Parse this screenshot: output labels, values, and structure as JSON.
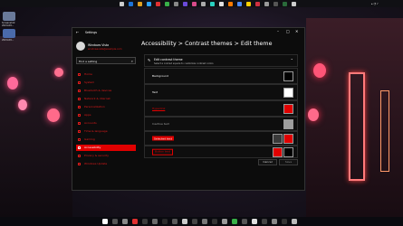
{
  "window": {
    "title": "Settings"
  },
  "profile": {
    "name": "Windows Vista",
    "email": "windowsvista@example.com"
  },
  "search": {
    "placeholder": "Find a setting"
  },
  "nav": [
    {
      "label": "Home"
    },
    {
      "label": "System"
    },
    {
      "label": "Bluetooth & devices"
    },
    {
      "label": "Network & internet"
    },
    {
      "label": "Personalization"
    },
    {
      "label": "Apps"
    },
    {
      "label": "Accounts"
    },
    {
      "label": "Time & language"
    },
    {
      "label": "Gaming"
    },
    {
      "label": "Accessibility"
    },
    {
      "label": "Privacy & security"
    },
    {
      "label": "Windows Update"
    }
  ],
  "breadcrumb": {
    "part1": "Accessibility",
    "sep1": ">",
    "part2": "Contrast themes",
    "sep2": ">",
    "part3": "Edit theme"
  },
  "edit": {
    "title": "Edit contrast theme",
    "subtitle": "Select a colored square to customize contrast colors"
  },
  "colors": {
    "background": {
      "label": "Background",
      "swatch": "#000000"
    },
    "text": {
      "label": "Text",
      "swatch": "#ffffff"
    },
    "hyperlink": {
      "label": "Hyperlink",
      "swatch": "#e00000"
    },
    "inactive": {
      "label": "Inactive text",
      "swatch": "#9e9e9e"
    },
    "selected": {
      "label": "Selected text",
      "swatch1": "#3a3a3a",
      "swatch2": "#e00000"
    },
    "button": {
      "label": "Button text",
      "swatch1": "#e00000",
      "swatch2": "#000000"
    }
  },
  "buttons": {
    "cancel": "Cancel",
    "save": "Save"
  },
  "accent": "#e00000"
}
